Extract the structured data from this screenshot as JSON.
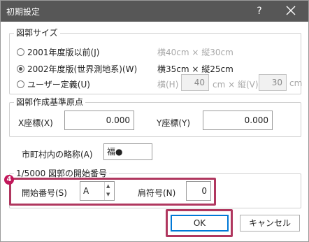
{
  "window": {
    "title": "初期設定",
    "help_label": "?"
  },
  "frame_size": {
    "group_title": "図郭サイズ",
    "options": [
      {
        "label": "2001年度版以前(J)",
        "dims": "横40cm × 縦30cm",
        "checked": false,
        "enabled": false
      },
      {
        "label": "2002年度版(世界測地系)(W)",
        "dims": "横35cm × 縦25cm",
        "checked": true,
        "enabled": true
      },
      {
        "label": "ユーザー定義(U)",
        "checked": false
      }
    ],
    "user_defined": {
      "width_label": "横(H)",
      "width_value": "40",
      "unit_x": "cm × 縦(V)",
      "height_value": "30",
      "unit_y": "cm"
    }
  },
  "origin": {
    "group_title": "図郭作成基準原点",
    "x_label": "X座標(X)",
    "x_value": "0.000",
    "y_label": "Y座標(Y)",
    "y_value": "0.000"
  },
  "municipality": {
    "label": "市町村内の略称(A)",
    "value": "福●"
  },
  "start_number": {
    "group_title": "1/5000 図郭の開始番号",
    "badge": "4",
    "start_label": "開始番号(S)",
    "start_value": "A",
    "suffix_label": "肩符号(N)",
    "suffix_value": "0"
  },
  "buttons": {
    "ok": "OK",
    "cancel": "キャンセル"
  },
  "colors": {
    "titlebar": "#575757",
    "highlight": "#b0375f",
    "badge": "#c2185b",
    "focus": "#0078d7"
  }
}
